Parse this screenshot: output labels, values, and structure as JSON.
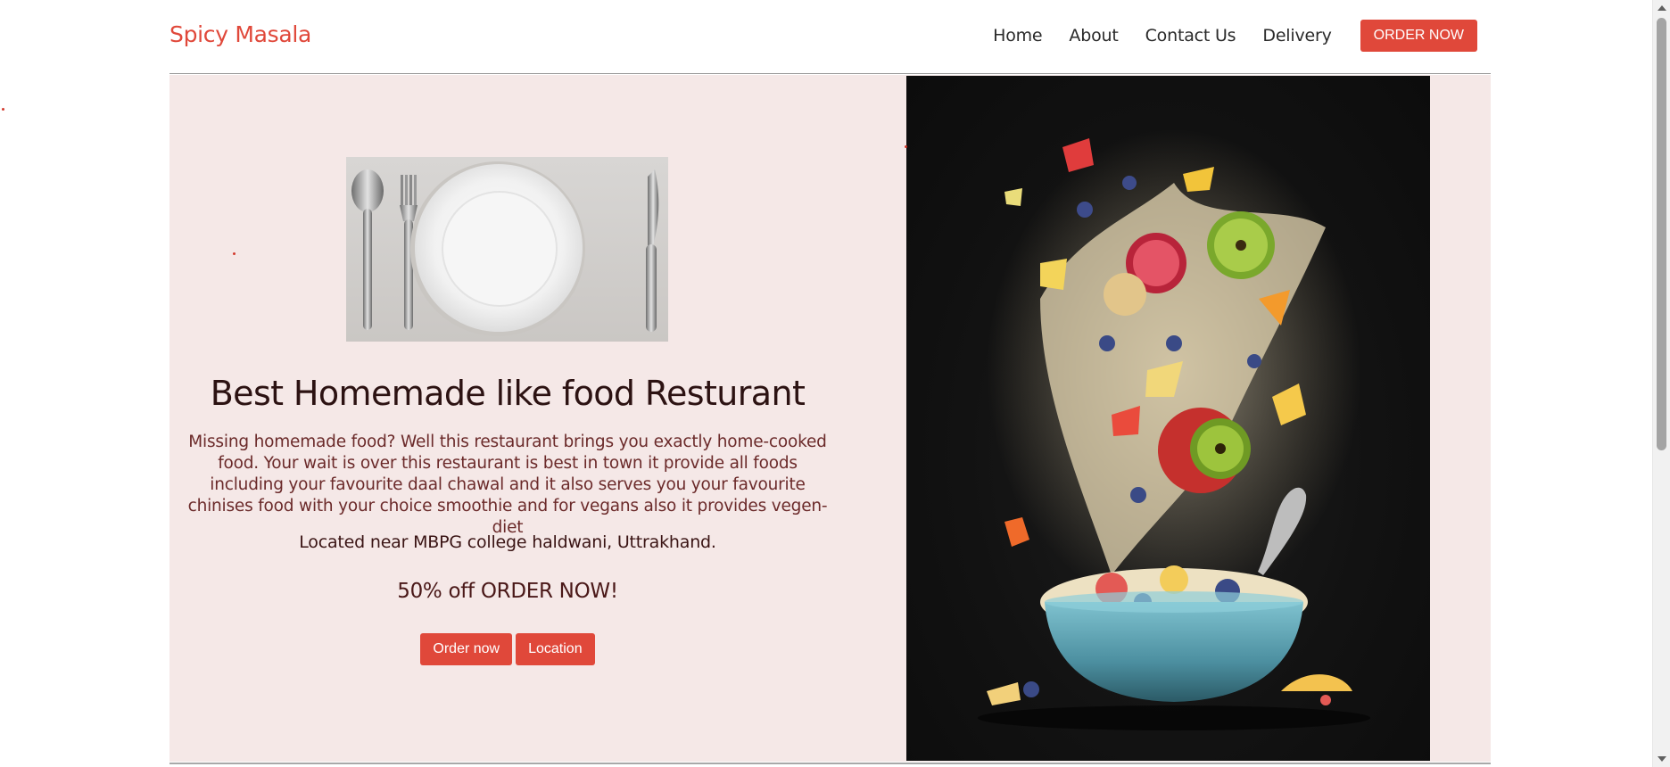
{
  "header": {
    "brand": "Spicy Masala",
    "nav": [
      "Home",
      "About",
      "Contact Us",
      "Delivery"
    ],
    "order_button": "ORDER NOW"
  },
  "hero": {
    "title": "Best Homemade like food Resturant",
    "description": "Missing homemade food? Well this restaurant brings you exactly home-cooked food. Your wait is over this restaurant is best in town it provide all foods including your favourite daal chawal and it also serves you your favourite chinises food with your choice smoothie and for vegans also it provides vegen-diet",
    "location": "Located near MBPG college haldwani, Uttrakhand.",
    "offer": "50% off ORDER NOW!",
    "buttons": {
      "order": "Order now",
      "location": "Location"
    }
  },
  "colors": {
    "accent": "#e0483a",
    "hero_background": "#f5e8e7"
  },
  "icons": [
    "plate-cutlery-image",
    "fruit-splash-bowl-image"
  ]
}
